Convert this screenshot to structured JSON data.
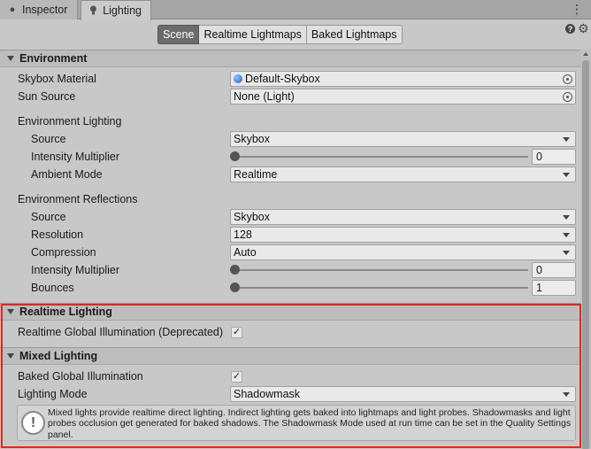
{
  "tabs": [
    {
      "label": "Inspector",
      "icon": "info-circle-icon"
    },
    {
      "label": "Lighting",
      "icon": "lightbulb-icon"
    }
  ],
  "modes": [
    "Scene",
    "Realtime Lightmaps",
    "Baked Lightmaps"
  ],
  "active_mode": "Scene",
  "environment": {
    "header": "Environment",
    "skybox_material": {
      "label": "Skybox Material",
      "value": "Default-Skybox"
    },
    "sun_source": {
      "label": "Sun Source",
      "value": "None (Light)"
    },
    "lighting_group": "Environment Lighting",
    "source": {
      "label": "Source",
      "value": "Skybox"
    },
    "intensity": {
      "label": "Intensity Multiplier",
      "value": "0"
    },
    "ambient_mode": {
      "label": "Ambient Mode",
      "value": "Realtime"
    },
    "reflections_group": "Environment Reflections",
    "refl_source": {
      "label": "Source",
      "value": "Skybox"
    },
    "resolution": {
      "label": "Resolution",
      "value": "128"
    },
    "compression": {
      "label": "Compression",
      "value": "Auto"
    },
    "refl_intensity": {
      "label": "Intensity Multiplier",
      "value": "0"
    },
    "bounces": {
      "label": "Bounces",
      "value": "1"
    }
  },
  "realtime_lighting": {
    "header": "Realtime Lighting",
    "gi": {
      "label": "Realtime Global Illumination (Deprecated)",
      "checked": true,
      "mark": "✓"
    }
  },
  "mixed_lighting": {
    "header": "Mixed Lighting",
    "baked_gi": {
      "label": "Baked Global Illumination",
      "checked": true,
      "mark": "✓"
    },
    "lighting_mode": {
      "label": "Lighting Mode",
      "value": "Shadowmask"
    },
    "help": "Mixed lights provide realtime direct lighting. Indirect lighting gets baked into lightmaps and light probes. Shadowmasks and light probes occlusion get generated for baked shadows. The Shadowmask Mode used at run time can be set in the Quality Settings panel."
  },
  "colors": {
    "highlight": "#e0281e",
    "active_mode_bg": "#6b6b6b"
  }
}
